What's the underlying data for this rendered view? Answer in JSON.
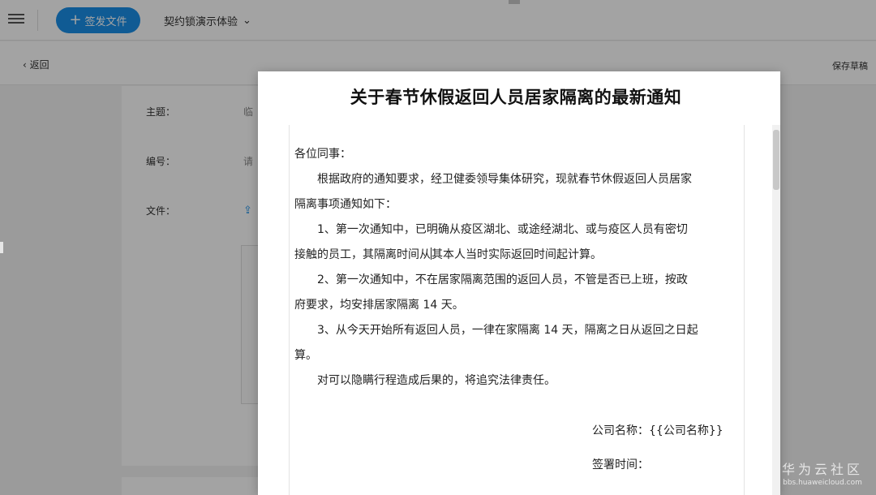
{
  "header": {
    "send_button": "+ 签发文件",
    "send_plus": "+",
    "send_label": "签发文件",
    "demo_selector": "契约锁演示体验",
    "chevron": "⌄"
  },
  "subbar": {
    "back_label": "返回",
    "save_draft_label": "保存草稿"
  },
  "form": {
    "subject_label": "主题：",
    "subject_value": "临",
    "number_label": "编号：",
    "number_value": "请",
    "file_label": "文件："
  },
  "document": {
    "title": "关于春节休假返回人员居家隔离的最新通知",
    "greeting": "各位同事：",
    "intro_line1": "根据政府的通知要求，经卫健委领导集体研究，现就春节休假返回人员居家",
    "intro_line2": "隔离事项通知如下：",
    "item1_line1": "1、第一次通知中，已明确从疫区湖北、或途经湖北、或与疫区人员有密切",
    "item1_line2_before_cursor": "接触的员工，其隔离时间从",
    "item1_line2_after_cursor": "其本人当时实际返回时间起计算。",
    "item2_line1": "2、第一次通知中，不在居家隔离范围的返回人员，不管是否已上班，按政",
    "item2_line2": "府要求，均安排居家隔离 14 天。",
    "item3_line1": "3、从今天开始所有返回人员，一律在家隔离 14 天，隔离之日从返回之日起",
    "item3_line2": "算。",
    "closing": "对可以隐瞒行程造成后果的，将追究法律责任。",
    "company_line": "公司名称：{{公司名称}}",
    "sign_time_line": "签署时间："
  },
  "watermark": {
    "main": "华为云社区",
    "sub": "bbs.huaweicloud.com"
  },
  "colors": {
    "accent": "#1a8fe8",
    "overlay": "rgba(0,0,0,0.36)"
  },
  "icons": [
    "menu-icon",
    "chevron-down-icon",
    "back-arrow-icon",
    "upload-icon"
  ]
}
